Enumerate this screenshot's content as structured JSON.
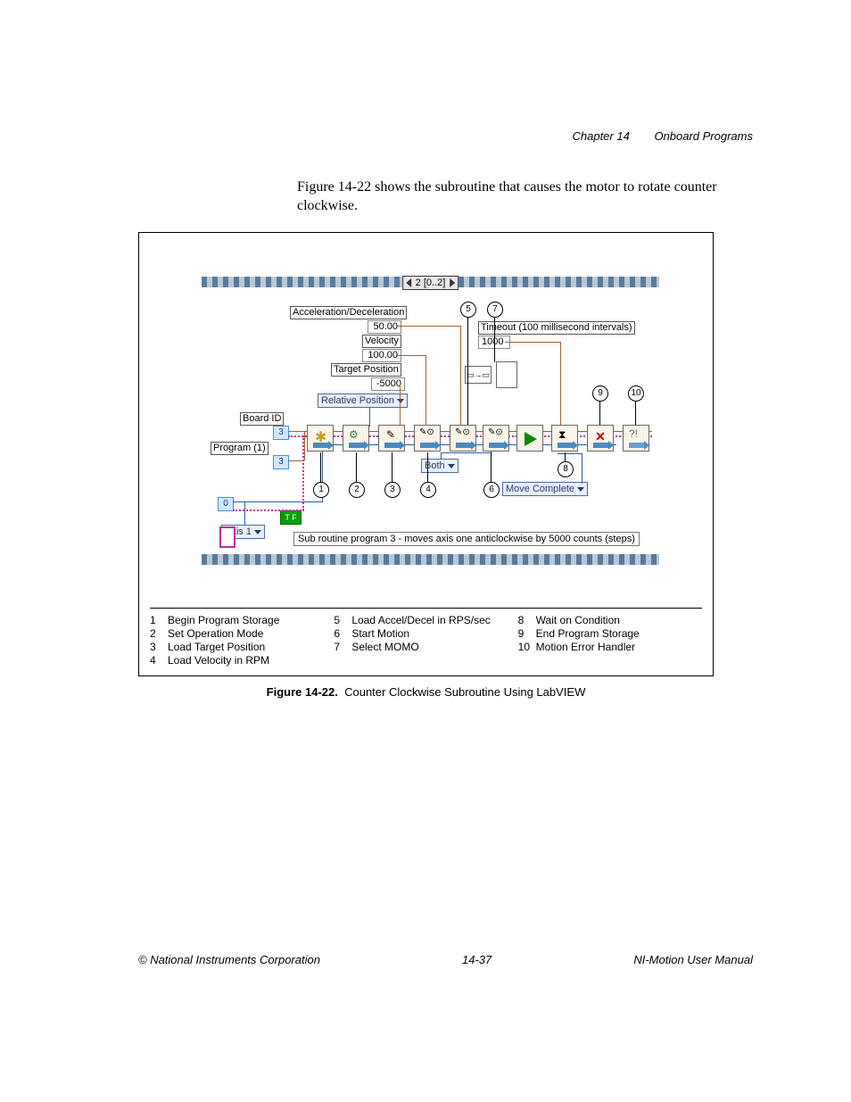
{
  "header": {
    "chapter": "Chapter 14",
    "title": "Onboard Programs"
  },
  "body_text": "Figure 14-22 shows the subroutine that causes the motor to rotate counter clockwise.",
  "diagram": {
    "loop_index": "2 [0..2]",
    "labels": {
      "accel": "Acceleration/Deceleration",
      "accel_val": "50.00",
      "velocity": "Velocity",
      "velocity_val": "100.00",
      "target_pos": "Target Position",
      "target_pos_val": "-5000",
      "rel_pos": "Relative Position",
      "board_id": "Board ID",
      "board_id_val": "3",
      "program": "Program (1)",
      "program_val": "3",
      "axis": "Axis 1",
      "timeout": "Timeout (100 millisecond intervals)",
      "timeout_val": "1000",
      "both": "Both",
      "move_complete": "Move Complete",
      "tf": "T F",
      "zero": "0"
    },
    "comment": "Sub routine program 3 - moves axis one anticlockwise by 5000 counts (steps)",
    "callouts": [
      "1",
      "2",
      "3",
      "4",
      "5",
      "6",
      "7",
      "8",
      "9",
      "10"
    ]
  },
  "legend": {
    "col1": [
      {
        "n": "1",
        "t": "Begin Program Storage"
      },
      {
        "n": "2",
        "t": "Set Operation Mode"
      },
      {
        "n": "3",
        "t": "Load Target Position"
      },
      {
        "n": "4",
        "t": "Load Velocity in RPM"
      }
    ],
    "col2": [
      {
        "n": "5",
        "t": "Load Accel/Decel in RPS/sec"
      },
      {
        "n": "6",
        "t": "Start Motion"
      },
      {
        "n": "7",
        "t": "Select MOMO"
      }
    ],
    "col3": [
      {
        "n": "8",
        "t": "Wait on Condition"
      },
      {
        "n": "9",
        "t": "End Program Storage"
      },
      {
        "n": "10",
        "t": "Motion Error Handler"
      }
    ]
  },
  "caption": {
    "label": "Figure 14-22.",
    "text": "Counter Clockwise Subroutine Using LabVIEW"
  },
  "footer": {
    "left": "© National Instruments Corporation",
    "center": "14-37",
    "right": "NI-Motion User Manual"
  }
}
